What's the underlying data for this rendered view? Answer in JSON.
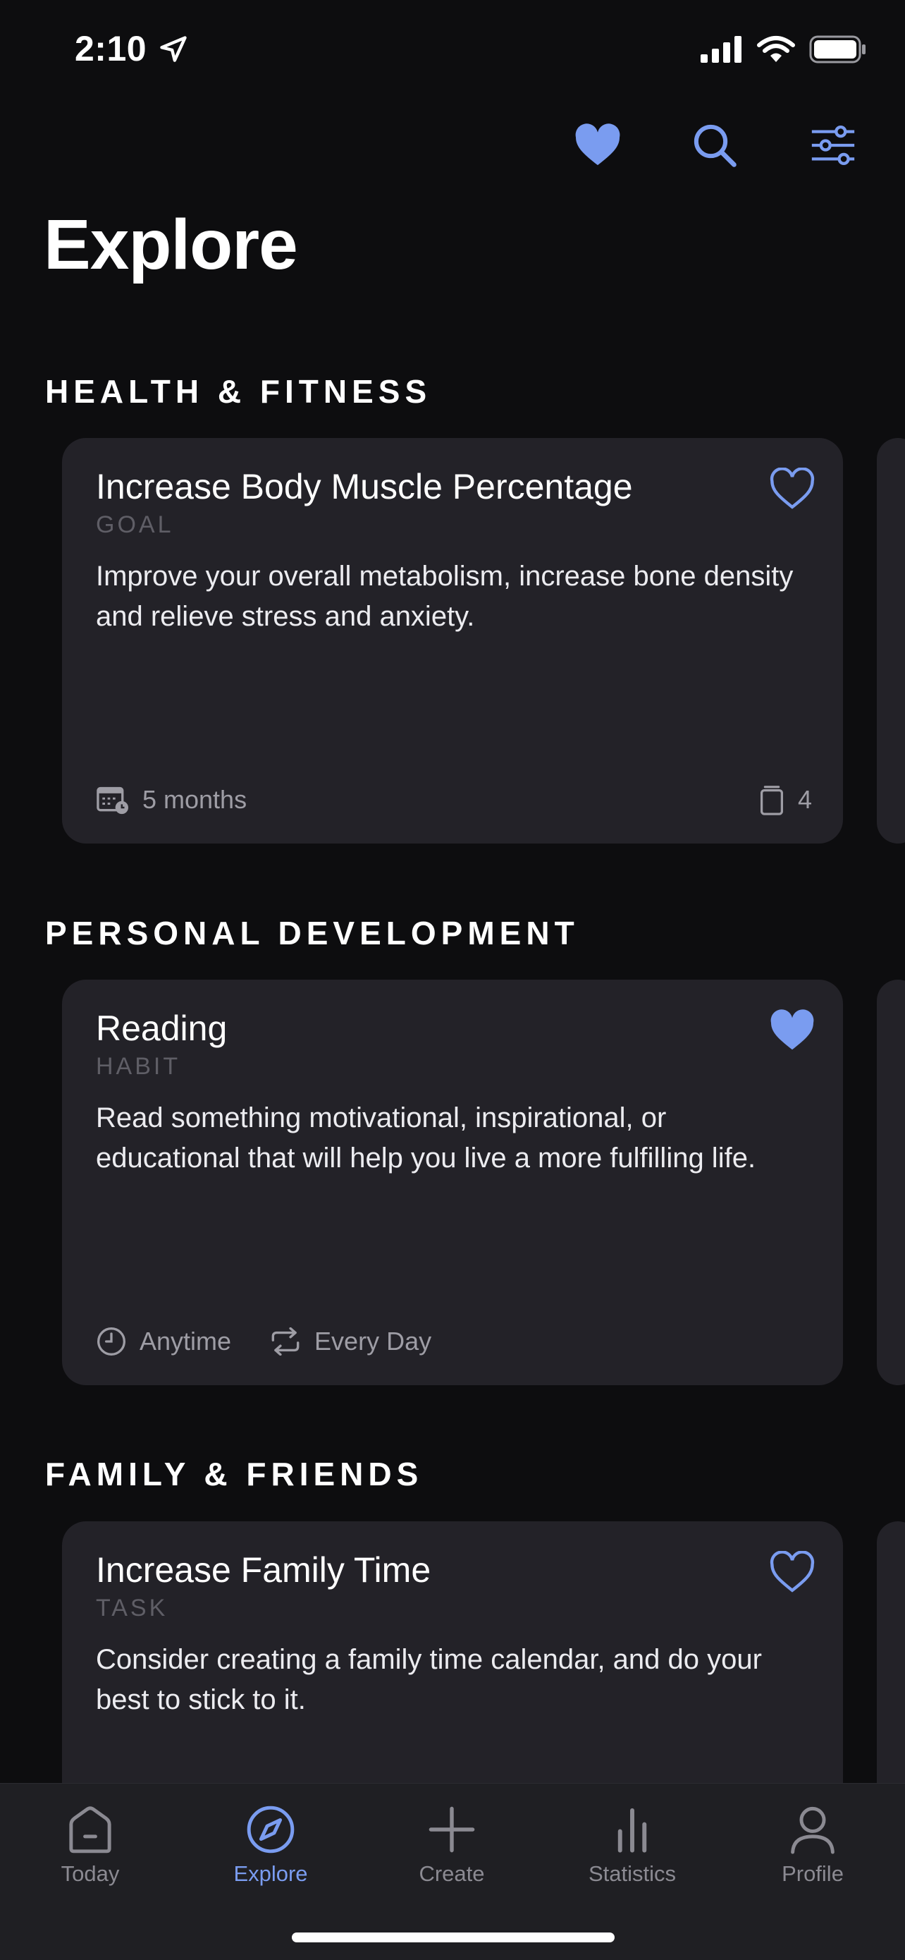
{
  "status_bar": {
    "time": "2:10"
  },
  "page": {
    "title": "Explore"
  },
  "colors": {
    "accent": "#7a9cf0",
    "background": "#0d0d0f",
    "card": "#232228"
  },
  "sections": [
    {
      "title": "HEALTH & FITNESS",
      "card": {
        "title": "Increase Body Muscle Percentage",
        "type": "GOAL",
        "description": "Improve your overall metabolism, increase bone density and relieve stress and anxiety.",
        "favorite": false,
        "duration": "5 months",
        "count": "4"
      }
    },
    {
      "title": "PERSONAL DEVELOPMENT",
      "card": {
        "title": "Reading",
        "type": "HABIT",
        "description": "Read something motivational, inspirational, or educational that will help you live a more fulfilling life.",
        "favorite": true,
        "time": "Anytime",
        "repeat": "Every Day"
      }
    },
    {
      "title": "FAMILY & FRIENDS",
      "card": {
        "title": "Increase Family Time",
        "type": "TASK",
        "description": "Consider creating a family time calendar, and do your best to stick to it.",
        "favorite": false
      }
    }
  ],
  "tabs": [
    {
      "label": "Today",
      "icon": "home-icon",
      "active": false
    },
    {
      "label": "Explore",
      "icon": "compass-icon",
      "active": true
    },
    {
      "label": "Create",
      "icon": "plus-icon",
      "active": false
    },
    {
      "label": "Statistics",
      "icon": "bar-chart-icon",
      "active": false
    },
    {
      "label": "Profile",
      "icon": "person-icon",
      "active": false
    }
  ]
}
